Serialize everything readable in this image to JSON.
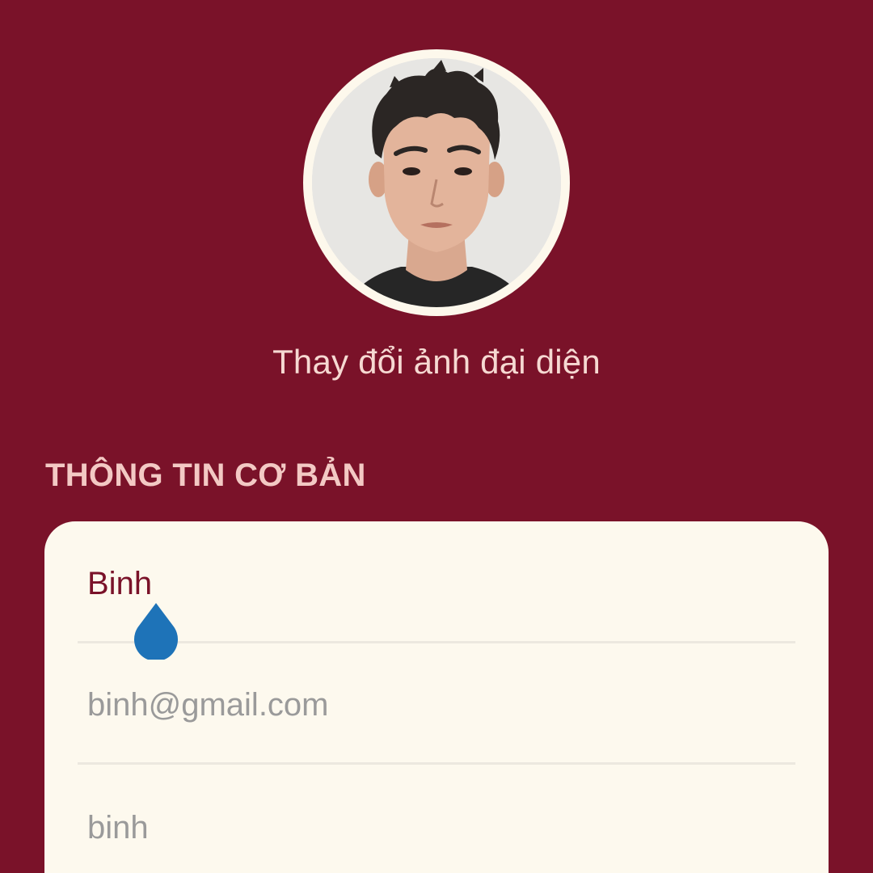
{
  "profile": {
    "change_photo_label": "Thay đổi ảnh đại diện",
    "avatar_icon": "profile-photo"
  },
  "basic_info": {
    "section_title": "THÔNG TIN CƠ BẢN",
    "name": {
      "value": "Binh"
    },
    "email": {
      "value": "binh@gmail.com"
    },
    "username": {
      "value": "binh"
    }
  },
  "colors": {
    "background": "#7a1229",
    "card": "#fdf9ee",
    "accent_text": "#7a1229",
    "muted_text": "#9a9a9a",
    "cursor_handle": "#1e73b8"
  }
}
